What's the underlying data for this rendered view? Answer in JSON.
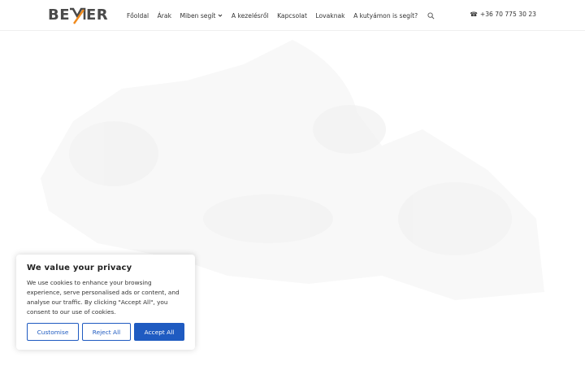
{
  "header": {
    "logo_text": "BEMER",
    "nav": [
      {
        "label": "Főoldal"
      },
      {
        "label": "Árak"
      },
      {
        "label": "Miben segít"
      },
      {
        "label": "A kezelésről"
      },
      {
        "label": "Kapcsolat"
      },
      {
        "label": "Lovaknak"
      },
      {
        "label": "A kutyámon is segít?"
      }
    ],
    "phone_icon": "☎",
    "phone": "+36 70 775 30 23",
    "icons": {
      "dropdown": "chevron-down-icon",
      "search": "search-icon",
      "phone": "phone-icon"
    }
  },
  "cookie_banner": {
    "title": "We value your privacy",
    "text": "We use cookies to enhance your browsing experience, serve personalised ads or content, and analyse our traffic. By clicking \"Accept All\", you consent to our use of cookies.",
    "customise": "Customise",
    "reject": "Reject All",
    "accept": "Accept All"
  },
  "colors": {
    "accent": "#1f5bc1",
    "logo_orange": "#f08a1c",
    "logo_gray": "#4a4a4a",
    "faint_graphic": "#f7f7f7"
  }
}
